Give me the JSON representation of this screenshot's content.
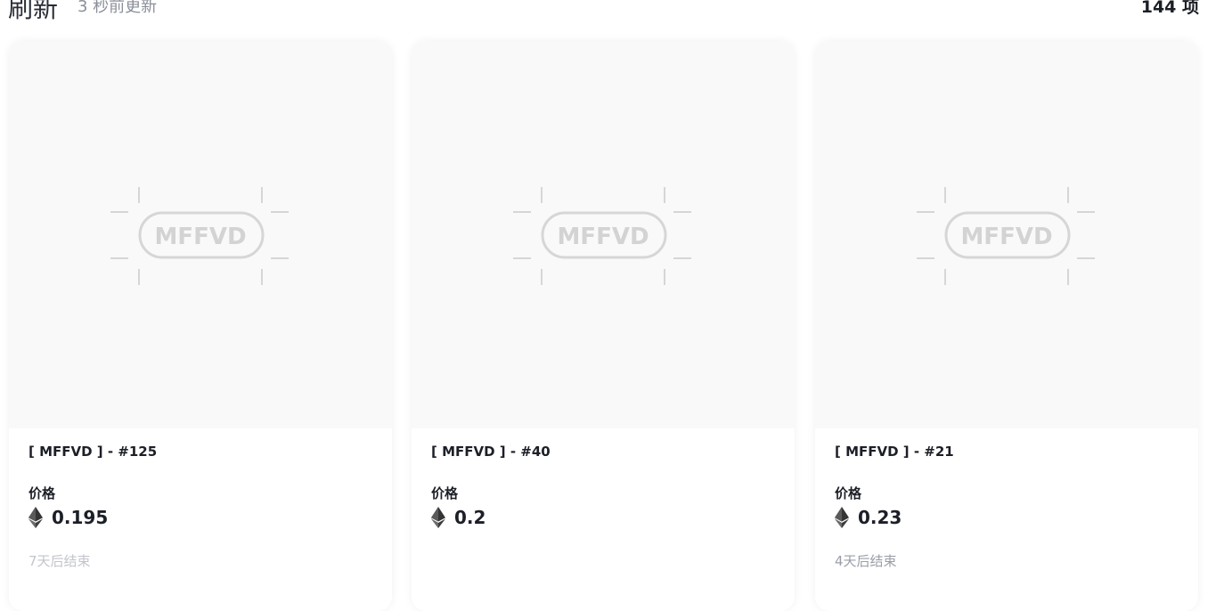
{
  "header": {
    "refresh_label": "刷新",
    "updated_text": "3 秒前更新",
    "item_count": "144 项"
  },
  "icons": {
    "currency": "ethereum-icon",
    "placeholder": "mffvd-logo-placeholder"
  },
  "placeholder_text": "MFFVD",
  "cards": [
    {
      "title": "[ MFFVD ] - #125",
      "price_label": "价格",
      "price": "0.195",
      "ends": "7天后结束"
    },
    {
      "title": "[ MFFVD ] - #40",
      "price_label": "价格",
      "price": "0.2",
      "ends": ""
    },
    {
      "title": "[ MFFVD ] - #21",
      "price_label": "价格",
      "price": "0.23",
      "ends": "4天后结束"
    }
  ],
  "colors": {
    "text_primary": "#1c1f27",
    "text_muted": "#8b8f99",
    "thumb_bg": "#f9f9fa",
    "logo_stroke": "#d3d3d3"
  }
}
